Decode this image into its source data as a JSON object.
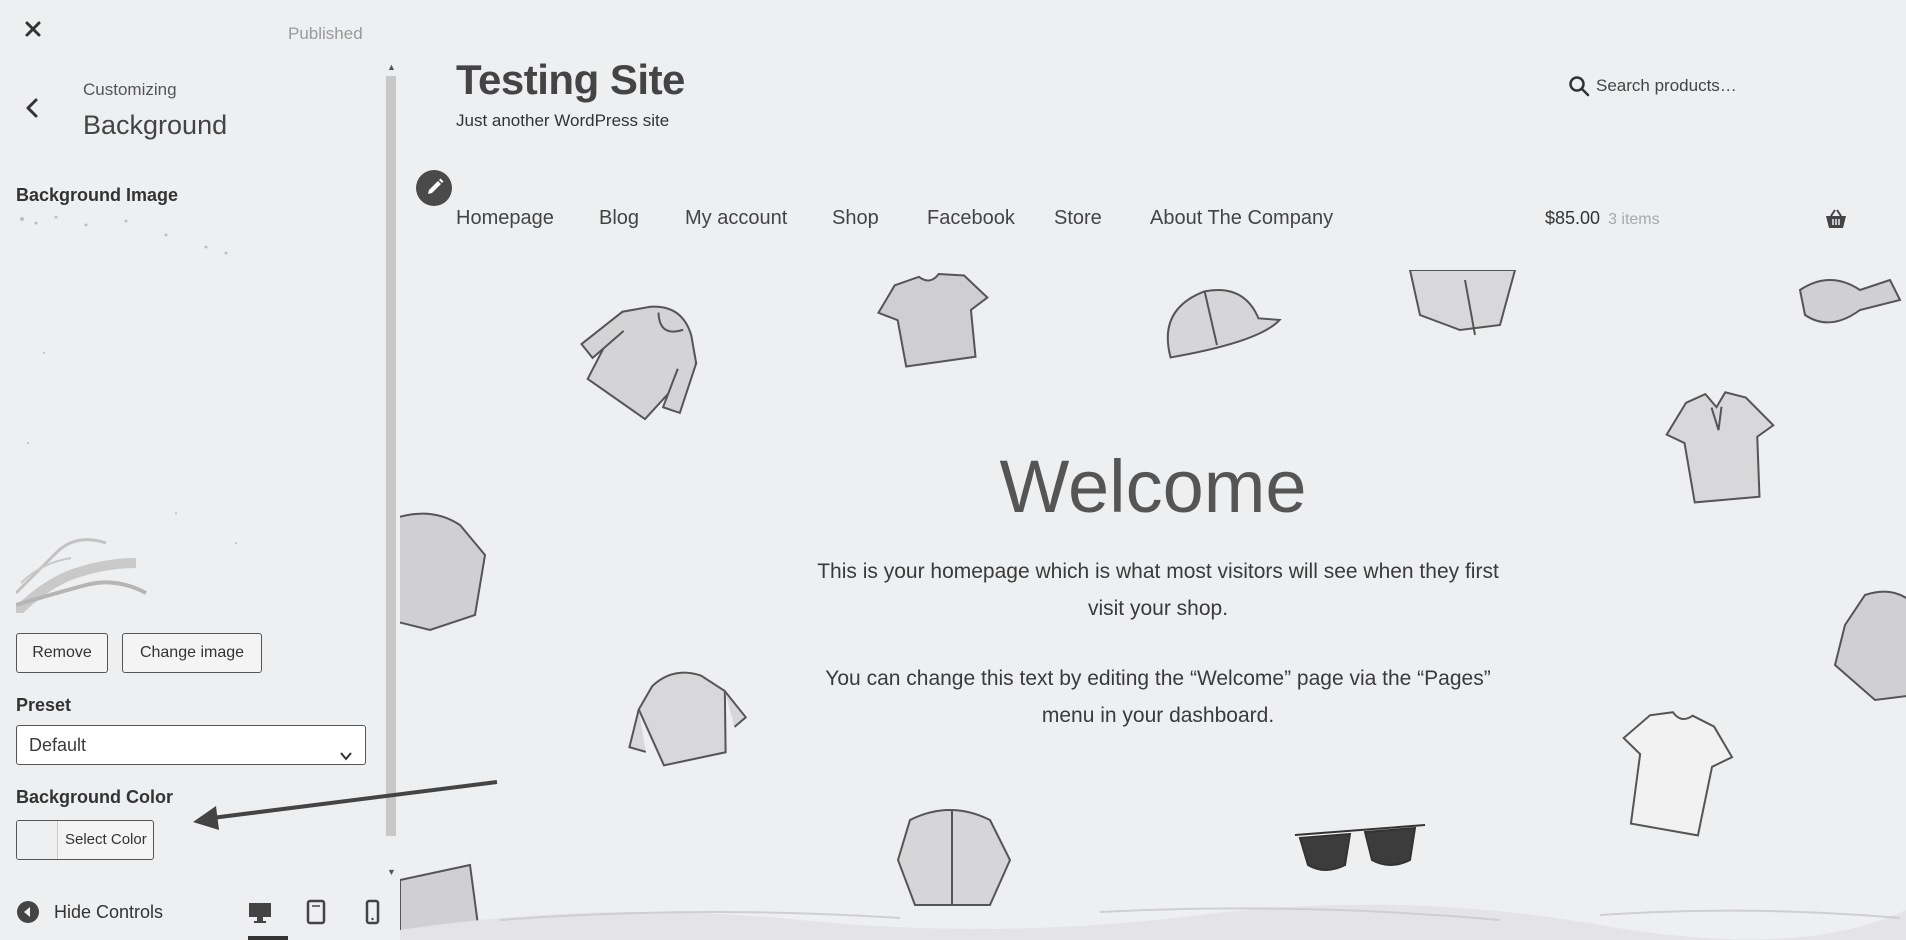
{
  "customizer": {
    "close_label": "×",
    "status": "Published",
    "breadcrumb": "Customizing",
    "section_title": "Background",
    "background_image_label": "Background Image",
    "remove_button": "Remove",
    "change_image_button": "Change image",
    "preset_label": "Preset",
    "preset_value": "Default",
    "background_color_label": "Background Color",
    "select_color_button": "Select Color",
    "hide_controls": "Hide Controls"
  },
  "site": {
    "title": "Testing Site",
    "tagline": "Just another WordPress site",
    "search_placeholder": "Search products…",
    "nav": [
      "Homepage",
      "Blog",
      "My account",
      "Shop",
      "Facebook",
      "Store",
      "About The Company"
    ],
    "cart_price": "$85.00",
    "cart_count": "3 items",
    "welcome_heading": "Welcome",
    "paragraph1_line1": "This is your homepage which is what most visitors will see when they first",
    "paragraph1_line2": "visit your shop.",
    "paragraph2_line1": "You can change this text by editing the “Welcome” page via the “Pages”",
    "paragraph2_line2": "menu in your dashboard."
  },
  "icons": {
    "close": "close-icon",
    "back": "chevron-left-icon",
    "chevron_down": "chevron-down-icon",
    "hide_controls": "collapse-icon",
    "desktop": "desktop-icon",
    "tablet": "tablet-icon",
    "mobile": "mobile-icon",
    "search": "search-icon",
    "edit": "pencil-icon",
    "cart": "basket-icon"
  },
  "colors": {
    "background": "#eeeff1",
    "text": "#444444",
    "edit_shortcut": "#4a4a4a"
  }
}
